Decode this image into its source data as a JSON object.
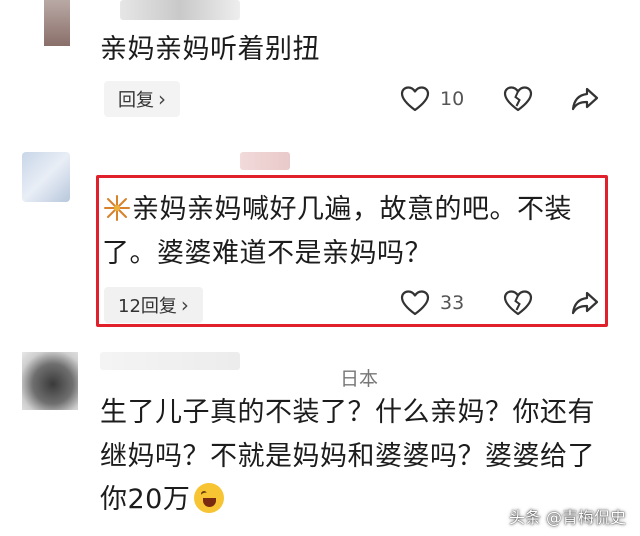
{
  "comments": [
    {
      "text": "亲妈亲妈听着别扭",
      "reply_label": "回复",
      "likes": "10"
    },
    {
      "emoji_icon": "fireworks-icon",
      "line1": "亲妈亲妈喊好几遍，故意的吧。不装",
      "line2": "了。婆婆难道不是亲妈吗？",
      "reply_label": "12回复",
      "likes": "33"
    },
    {
      "location": "日本",
      "line1": "生了儿子真的不装了？什么亲妈？你还有",
      "line2": "继妈吗？不就是妈妈和婆婆吗？婆婆给了",
      "line3": "你20万",
      "emoji_icon": "laughing-crying-emoji-icon"
    }
  ],
  "highlight_color": "#e0202a",
  "watermark": "头条 @青梅侃史"
}
